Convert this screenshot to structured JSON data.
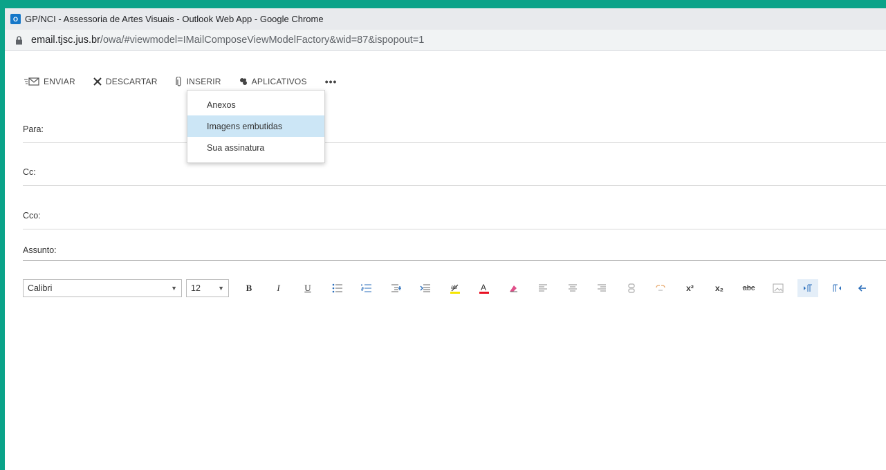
{
  "browser": {
    "title": "GP/NCI - Assessoria de Artes Visuais - Outlook Web App - Google Chrome",
    "app_icon_label": "O",
    "url_host": "email.tjsc.jus.br",
    "url_path": "/owa/#viewmodel=IMailComposeViewModelFactory&wid=87&ispopout=1"
  },
  "toolbar": {
    "send_label": "ENVIAR",
    "discard_label": "DESCARTAR",
    "insert_label": "INSERIR",
    "apps_label": "APLICATIVOS",
    "more_label": "•••"
  },
  "insert_menu": {
    "items": [
      {
        "label": "Anexos",
        "selected": false
      },
      {
        "label": "Imagens embutidas",
        "selected": true
      },
      {
        "label": "Sua assinatura",
        "selected": false
      }
    ]
  },
  "fields": {
    "to_label": "Para:",
    "cc_label": "Cc:",
    "bcc_label": "Cco:",
    "subject_label": "Assunto:"
  },
  "format": {
    "font": "Calibri",
    "size": "12",
    "bold": "B",
    "italic": "I",
    "underline": "U",
    "superscript": "x²",
    "subscript": "x₂",
    "strikethrough": "abc",
    "accent_color": "#e81123",
    "highlight_color": "#f6e600"
  }
}
